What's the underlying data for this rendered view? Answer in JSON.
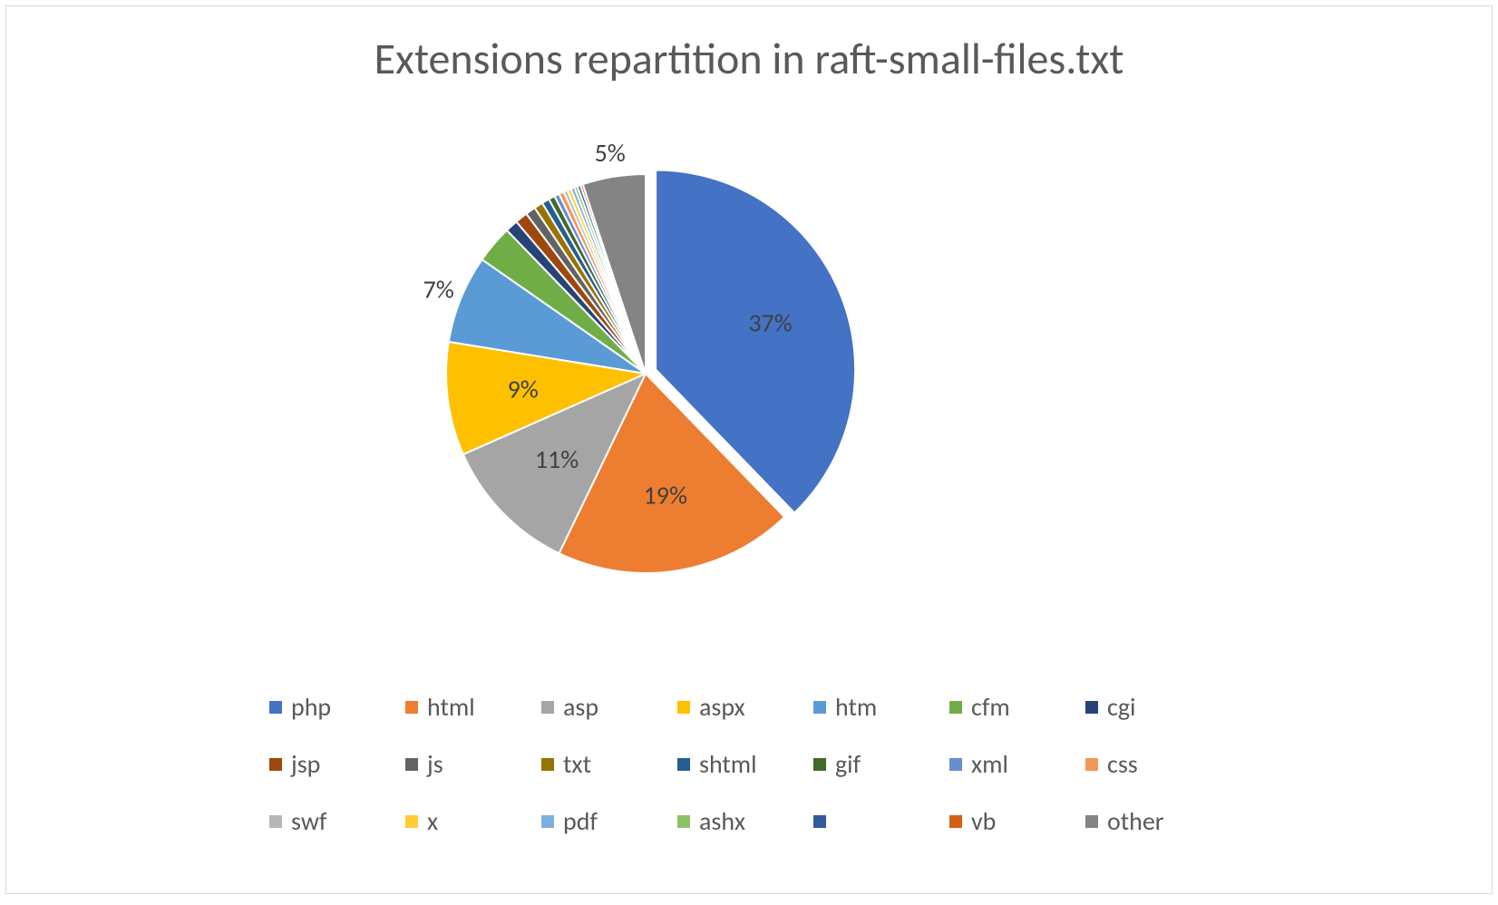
{
  "chart_data": {
    "type": "pie",
    "title": "Extensions repartition in raft-small-files.txt",
    "series": [
      {
        "name": "php",
        "value": 37,
        "color": "#4472c4",
        "label": "37%"
      },
      {
        "name": "html",
        "value": 19,
        "color": "#ed7d31",
        "label": "19%"
      },
      {
        "name": "asp",
        "value": 11,
        "color": "#a5a5a5",
        "label": "11%"
      },
      {
        "name": "aspx",
        "value": 9,
        "color": "#ffc000",
        "label": "9%"
      },
      {
        "name": "htm",
        "value": 7,
        "color": "#5b9bd5",
        "label": "7%"
      },
      {
        "name": "cfm",
        "value": 3,
        "color": "#70ad47",
        "label": ""
      },
      {
        "name": "cgi",
        "value": 1,
        "color": "#264478",
        "label": ""
      },
      {
        "name": "jsp",
        "value": 1,
        "color": "#9e480e",
        "label": ""
      },
      {
        "name": "js",
        "value": 0.8,
        "color": "#636363",
        "label": ""
      },
      {
        "name": "txt",
        "value": 0.7,
        "color": "#997300",
        "label": ""
      },
      {
        "name": "shtml",
        "value": 0.6,
        "color": "#255e91",
        "label": ""
      },
      {
        "name": "gif",
        "value": 0.5,
        "color": "#43682b",
        "label": ""
      },
      {
        "name": "xml",
        "value": 0.4,
        "color": "#698ed0",
        "label": ""
      },
      {
        "name": "css",
        "value": 0.4,
        "color": "#f1975a",
        "label": ""
      },
      {
        "name": "swf",
        "value": 0.3,
        "color": "#b7b7b7",
        "label": ""
      },
      {
        "name": "x",
        "value": 0.3,
        "color": "#ffcd33",
        "label": ""
      },
      {
        "name": "pdf",
        "value": 0.3,
        "color": "#7cafdd",
        "label": ""
      },
      {
        "name": "ashx",
        "value": 0.25,
        "color": "#8cc168",
        "label": ""
      },
      {
        "name": "",
        "value": 0.25,
        "color": "#335aa1",
        "label": ""
      },
      {
        "name": "vb",
        "value": 0.2,
        "color": "#d26012",
        "label": ""
      },
      {
        "name": "other",
        "value": 5,
        "color": "#848484",
        "label": "5%"
      }
    ],
    "legend_rows": [
      [
        "php",
        "html",
        "asp",
        "aspx",
        "htm",
        "cfm",
        "cgi"
      ],
      [
        "jsp",
        "js",
        "txt",
        "shtml",
        "gif",
        "xml",
        "css"
      ],
      [
        "swf",
        "x",
        "pdf",
        "ashx",
        "",
        "vb",
        "other"
      ]
    ]
  }
}
